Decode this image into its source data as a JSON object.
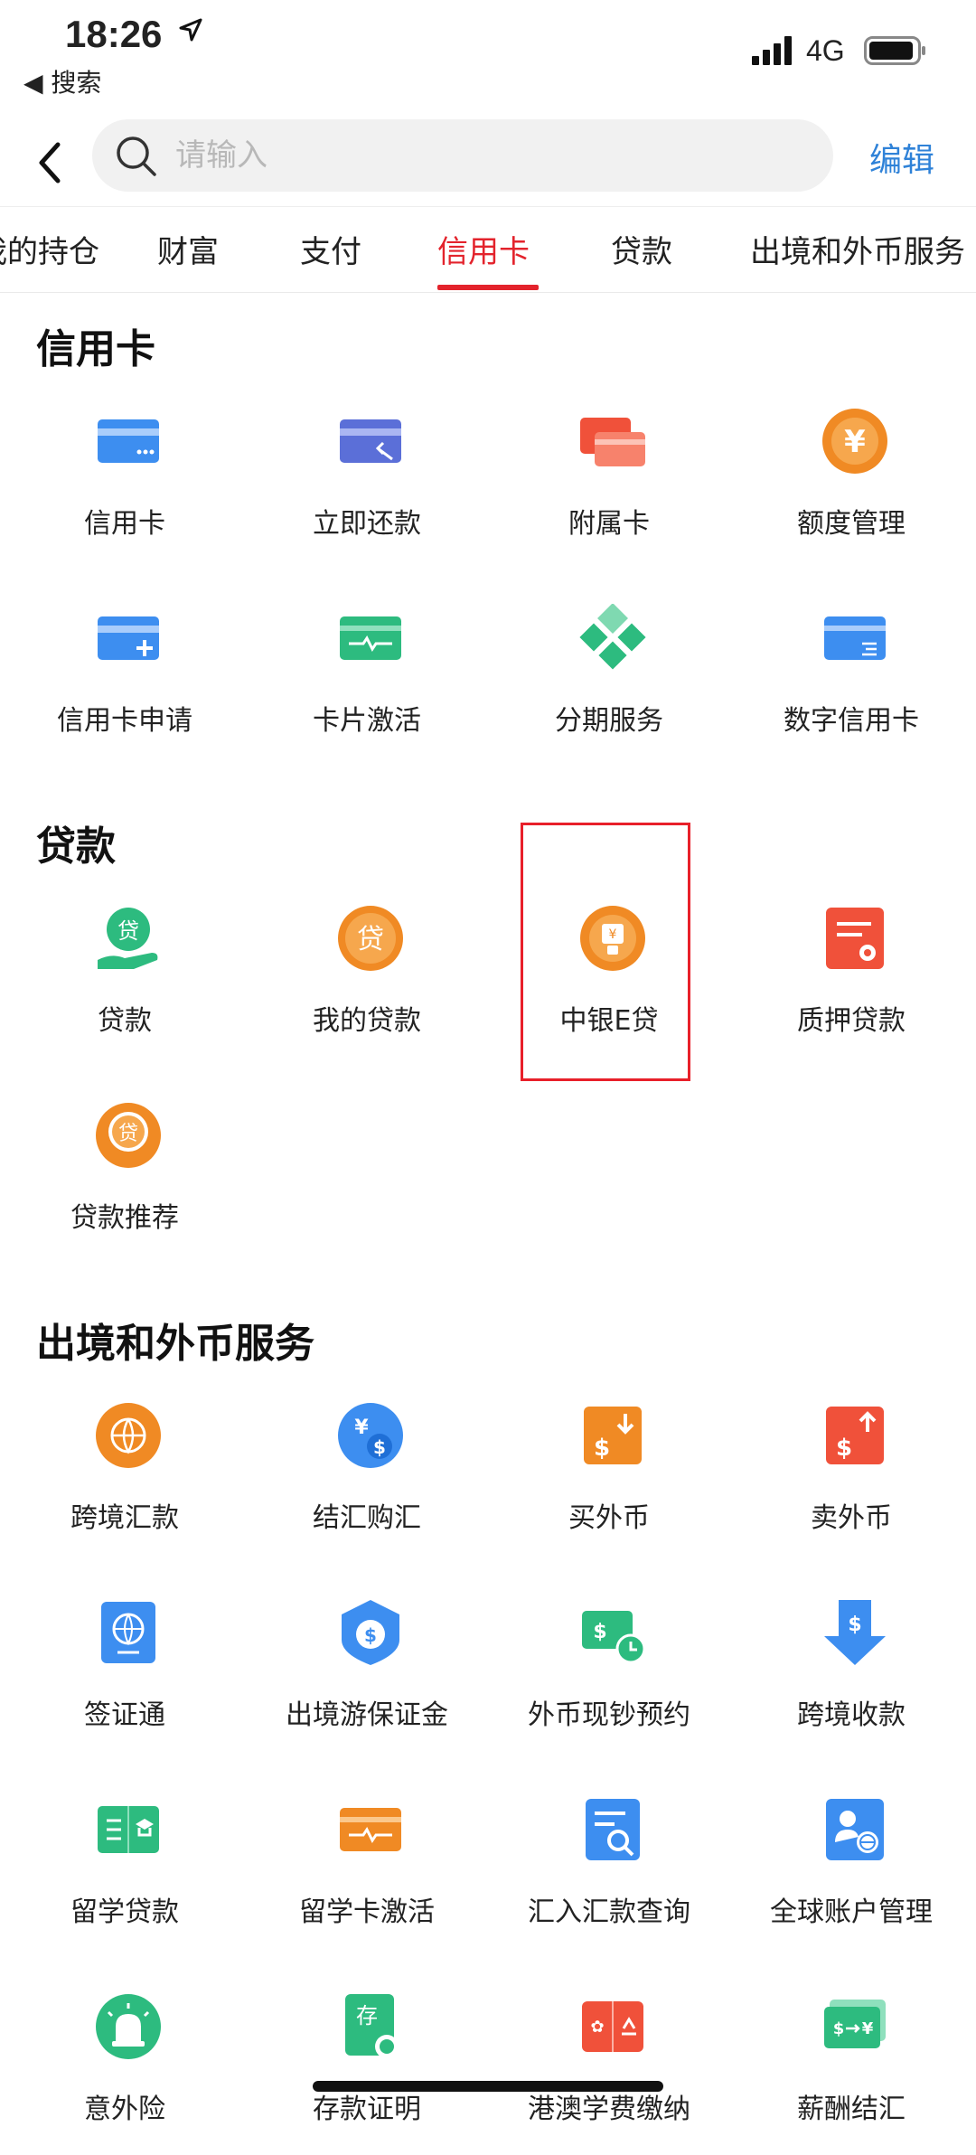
{
  "status_bar": {
    "time": "18:26",
    "back_app": "◀ 搜索",
    "network": "4G"
  },
  "search": {
    "placeholder": "请输入",
    "edit_label": "编辑"
  },
  "tabs": [
    {
      "label": "我的持仓"
    },
    {
      "label": "财富"
    },
    {
      "label": "支付"
    },
    {
      "label": "信用卡",
      "active": true
    },
    {
      "label": "贷款"
    },
    {
      "label": "出境和外币服务"
    }
  ],
  "sections": [
    {
      "title": "信用卡",
      "items": [
        {
          "label": "信用卡",
          "icon": "credit-card-icon",
          "color": "#3d8ef0"
        },
        {
          "label": "立即还款",
          "icon": "card-repay-icon",
          "color": "#5b6fd8"
        },
        {
          "label": "附属卡",
          "icon": "supplementary-card-icon",
          "color": "#f0513a"
        },
        {
          "label": "额度管理",
          "icon": "yen-coin-icon",
          "color": "#f08a24"
        },
        {
          "label": "信用卡申请",
          "icon": "card-apply-icon",
          "color": "#3d8ef0"
        },
        {
          "label": "卡片激活",
          "icon": "card-activate-icon",
          "color": "#2dbb7f"
        },
        {
          "label": "分期服务",
          "icon": "installment-icon",
          "color": "#2dbb7f"
        },
        {
          "label": "数字信用卡",
          "icon": "digital-card-icon",
          "color": "#3d8ef0"
        }
      ]
    },
    {
      "title": "贷款",
      "items": [
        {
          "label": "贷款",
          "icon": "loan-hand-icon",
          "color": "#2dbb7f"
        },
        {
          "label": "我的贷款",
          "icon": "my-loan-icon",
          "color": "#f08a24"
        },
        {
          "label": "中银E贷",
          "icon": "e-loan-icon",
          "color": "#f08a24"
        },
        {
          "label": "质押贷款",
          "icon": "pledge-loan-icon",
          "color": "#f0513a"
        },
        {
          "label": "贷款推荐",
          "icon": "loan-recommend-icon",
          "color": "#f08a24"
        }
      ]
    },
    {
      "title": "出境和外币服务",
      "items": [
        {
          "label": "跨境汇款",
          "icon": "globe-coin-icon",
          "color": "#f08a24"
        },
        {
          "label": "结汇购汇",
          "icon": "exchange-coin-icon",
          "color": "#3d8ef0"
        },
        {
          "label": "买外币",
          "icon": "buy-currency-icon",
          "color": "#f08a24"
        },
        {
          "label": "卖外币",
          "icon": "sell-currency-icon",
          "color": "#f0513a"
        },
        {
          "label": "签证通",
          "icon": "visa-icon",
          "color": "#3d8ef0"
        },
        {
          "label": "出境游保证金",
          "icon": "deposit-shield-icon",
          "color": "#3d8ef0"
        },
        {
          "label": "外币现钞预约",
          "icon": "cash-reserve-icon",
          "color": "#2dbb7f"
        },
        {
          "label": "跨境收款",
          "icon": "receive-arrow-icon",
          "color": "#3d8ef0"
        },
        {
          "label": "留学贷款",
          "icon": "study-loan-icon",
          "color": "#2dbb7f"
        },
        {
          "label": "留学卡激活",
          "icon": "study-card-icon",
          "color": "#f08a24"
        },
        {
          "label": "汇入汇款查询",
          "icon": "remit-query-icon",
          "color": "#3d8ef0"
        },
        {
          "label": "全球账户管理",
          "icon": "global-account-icon",
          "color": "#3d8ef0"
        },
        {
          "label": "意外险",
          "icon": "alarm-icon",
          "color": "#2dbb7f"
        },
        {
          "label": "存款证明",
          "icon": "deposit-cert-icon",
          "color": "#2dbb7f"
        },
        {
          "label": "港澳学费缴纳",
          "icon": "tuition-icon",
          "color": "#f0513a"
        },
        {
          "label": "薪酬结汇",
          "icon": "salary-exchange-icon",
          "color": "#2dbb7f"
        }
      ]
    }
  ]
}
